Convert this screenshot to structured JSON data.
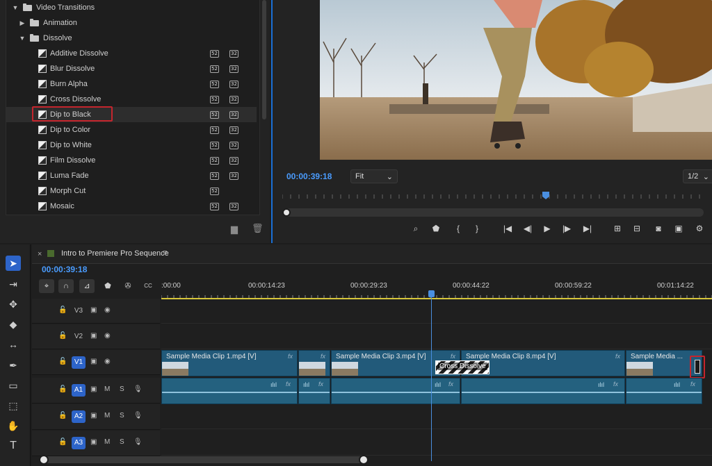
{
  "effects_tree": {
    "folder_video_transitions": "Video Transitions",
    "folder_animation": "Animation",
    "folder_dissolve": "Dissolve",
    "items": [
      {
        "label": "Additive Dissolve",
        "badge32": true
      },
      {
        "label": "Blur Dissolve",
        "badge32": true
      },
      {
        "label": "Burn Alpha",
        "badge32": true
      },
      {
        "label": "Cross Dissolve",
        "badge32": true
      },
      {
        "label": "Dip to Black",
        "badge32": true,
        "selected": true
      },
      {
        "label": "Dip to Color",
        "badge32": true
      },
      {
        "label": "Dip to White",
        "badge32": true
      },
      {
        "label": "Film Dissolve",
        "badge32": true
      },
      {
        "label": "Luma Fade",
        "badge32": true
      },
      {
        "label": "Morph Cut",
        "badge32": false
      },
      {
        "label": "Mosaic",
        "badge32": true
      }
    ],
    "badge_accel": "52",
    "badge_32": "32"
  },
  "program_monitor": {
    "timecode": "00:00:39:18",
    "zoom_select": "Fit",
    "resolution_select": "1/2"
  },
  "timeline": {
    "sequence_name": "Intro to Premiere Pro Sequence",
    "timecode": "00:00:39:18",
    "ruler_labels": [
      ":00:00",
      "00:00:14:23",
      "00:00:29:23",
      "00:00:44:22",
      "00:00:59:22",
      "00:01:14:22"
    ],
    "video_tracks": [
      "V3",
      "V2",
      "V1"
    ],
    "audio_tracks": [
      "A1",
      "A2",
      "A3"
    ],
    "track_m": "M",
    "track_s": "S",
    "fx": "fx",
    "clips": [
      "Sample Media Clip 1.mp4 [V]",
      "Sample Media Clip 3.mp4 [V]",
      "Sample Media Clip 8.mp4 [V]",
      "Sample Media ..."
    ],
    "transition_label": "Cross Dissolve",
    "cc_label": "CC"
  },
  "colors": {
    "accent_blue": "#4a9cff",
    "highlight_red": "#c5252d",
    "clip_blue": "#225a7a"
  }
}
